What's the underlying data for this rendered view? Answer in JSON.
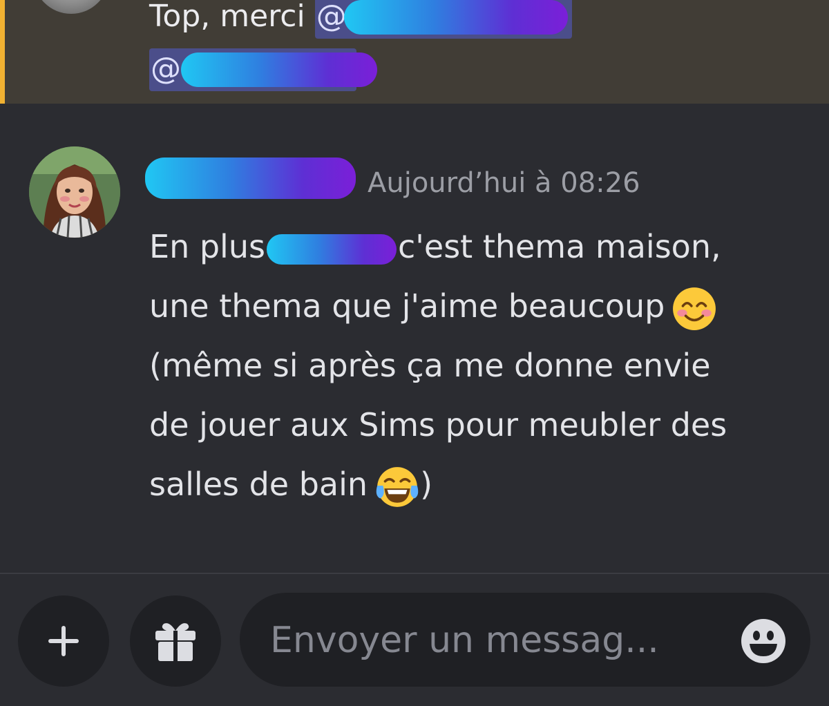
{
  "previous_message": {
    "text_prefix": "Top, merci",
    "mention_at": "@",
    "mention_2_at": "@"
  },
  "message": {
    "timestamp": "Aujourd’hui à 08:26",
    "lines": [
      {
        "before": "En plus",
        "after": "c'est thema maison,"
      },
      {
        "text": "une thema que j'aime beaucoup"
      },
      {
        "text": "(même si après ça me donne envie"
      },
      {
        "text": "de jouer aux Sims pour meubler des"
      },
      {
        "before": "salles de bain",
        "after": ")"
      }
    ]
  },
  "composer": {
    "placeholder": "Envoyer un messag...",
    "icons": {
      "attach": "plus-icon",
      "gift": "gift-icon",
      "emoji": "emoji-icon"
    }
  },
  "colors": {
    "background": "#2b2c31",
    "highlight": "#413d36",
    "highlight_bar": "#f0b132",
    "mention_bg": "#4b4e8a",
    "timestamp": "#9c9ea5",
    "input_bg": "#1f2024"
  }
}
